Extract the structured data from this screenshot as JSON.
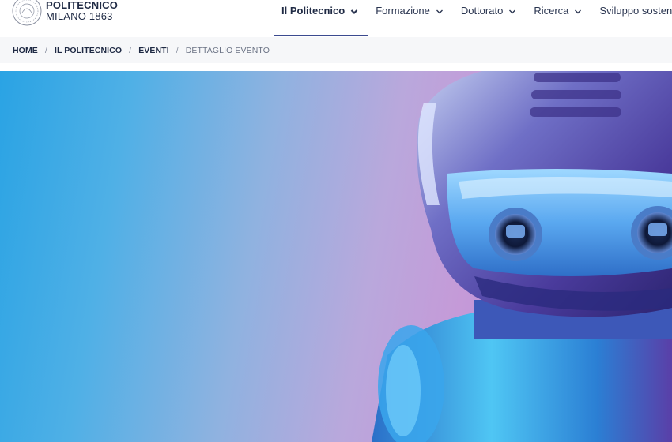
{
  "header": {
    "logo": {
      "line1": "POLITECNICO",
      "line2": "MILANO 1863"
    },
    "nav": [
      {
        "label": "Il Politecnico",
        "active": true
      },
      {
        "label": "Formazione",
        "active": false
      },
      {
        "label": "Dottorato",
        "active": false
      },
      {
        "label": "Ricerca",
        "active": false
      },
      {
        "label": "Sviluppo sostenibile",
        "active": false
      }
    ]
  },
  "breadcrumb": {
    "items": [
      "HOME",
      "IL POLITECNICO",
      "EVENTI",
      "DETTAGLIO EVENTO"
    ],
    "separator": "/"
  },
  "hero": {
    "image": "robot-illustration",
    "gradient_colors": [
      "#2aa3e4",
      "#b9a8dc",
      "#a784d4"
    ]
  },
  "colors": {
    "brand": "#1f2a44",
    "accent": "#3b4a8f"
  }
}
